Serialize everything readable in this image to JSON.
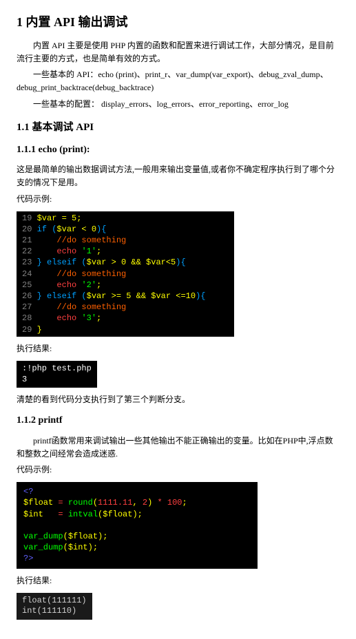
{
  "h1": "1  内置 API 输出调试",
  "intro1": "内置 API 主要是使用 PHP 内置的函数和配置来进行调试工作，大部分情况，是目前流行主要的方式，也是简单有效的方式。",
  "intro2_a": "一些基本的 API：echo (print)、print_r、var_dump(var_export)、debug_zval_dump、",
  "intro2_b": "debug_print_backtrace(debug_backtrace)",
  "intro3": "一些基本的配置：  display_errors、log_errors、error_reporting、error_log",
  "h2_1": "1.1  基本调试 API",
  "h3_1": "1.1.1  echo (print):",
  "p1": "这是最简单的输出数据调试方法,一般用来输出变量值,或者你不确定程序执行到了哪个分支的情况下是用。",
  "label_code": "代码示例:",
  "code1": {
    "l19": "$var = 5;",
    "l20a": "if (",
    "l20b": "$var < 0",
    "l20c": "){",
    "l21": "//do something",
    "l22a": "echo ",
    "l22b": "'1'",
    "l23a": "} elseif (",
    "l23b": "$var > 0 && $var<5",
    "l23c": "){",
    "l24": "//do something",
    "l25a": "echo ",
    "l25b": "'2'",
    "l26a": "} elseif (",
    "l26b": "$var >= 5 && $var <=10",
    "l26c": "){",
    "l27": "//do something",
    "l28a": "echo ",
    "l28b": "'3'",
    "l29": "}"
  },
  "label_result": "执行结果:",
  "term1": ":!php test.php\n3",
  "p2": "清楚的看到代码分支执行到了第三个判断分支。",
  "h3_2": "1.1.2  printf",
  "p3": "printf函数常用来调试输出一些其他输出不能正确输出的变量。比如在PHP中,浮点数和整数之间经常会造成迷惑.",
  "code2": {
    "open": "<?",
    "l1a": "$float ",
    "l1b": "= ",
    "l1c": "round",
    "l1d": "(",
    "l1e": "1111.11",
    "l1f": ", ",
    "l1g": "2",
    "l1h": ")",
    "l1i": " * ",
    "l1j": "100",
    "l2a": "$int   ",
    "l2b": "= ",
    "l2c": "intval",
    "l2d": "(",
    "l2e": "$float",
    "l2f": ")",
    "l4a": "var_dump",
    "l4b": "(",
    "l4c": "$float",
    "l4d": ")",
    "l5a": "var_dump",
    "l5b": "(",
    "l5c": "$int",
    "l5d": ")",
    "close": "?>"
  },
  "out2": "float(111111)\nint(111110)"
}
